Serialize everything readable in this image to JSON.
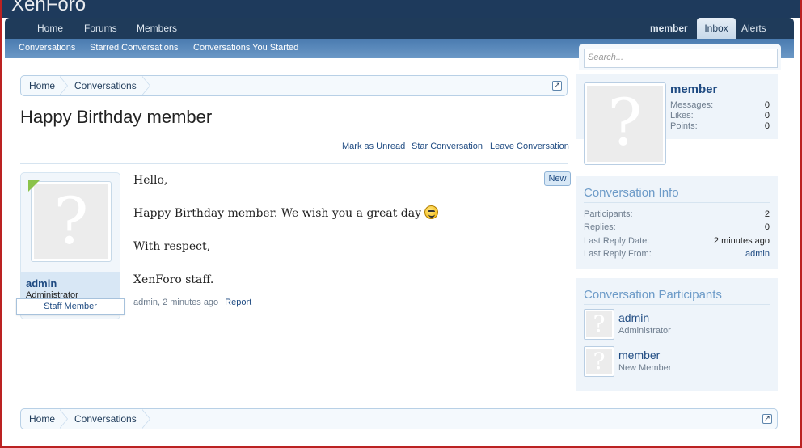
{
  "header": {
    "logo": "XenForo"
  },
  "nav": {
    "tabs": [
      "Home",
      "Forums",
      "Members"
    ],
    "user": "member",
    "inbox": "Inbox",
    "alerts": "Alerts"
  },
  "subnav": [
    "Conversations",
    "Starred Conversations",
    "Conversations You Started"
  ],
  "search": {
    "placeholder": "Search..."
  },
  "breadcrumb": [
    "Home",
    "Conversations"
  ],
  "page": {
    "title": "Happy Birthday member",
    "actions": [
      "Mark as Unread",
      "Star Conversation",
      "Leave Conversation"
    ]
  },
  "message": {
    "author": "admin",
    "author_title": "Administrator",
    "badge": "Staff Member",
    "new_label": "New",
    "lines": [
      "Hello,",
      "Happy Birthday member. We wish you a great day",
      "With respect,",
      "XenForo staff."
    ],
    "meta": "admin, 2 minutes ago",
    "report": "Report"
  },
  "sidebar": {
    "visitor": {
      "name": "member",
      "stats": [
        {
          "label": "Messages:",
          "value": "0"
        },
        {
          "label": "Likes:",
          "value": "0"
        },
        {
          "label": "Points:",
          "value": "0"
        }
      ]
    },
    "info": {
      "heading": "Conversation Info",
      "rows": [
        {
          "label": "Participants:",
          "value": "2"
        },
        {
          "label": "Replies:",
          "value": "0"
        },
        {
          "label": "Last Reply Date:",
          "value": "2 minutes ago"
        },
        {
          "label": "Last Reply From:",
          "value": "admin"
        }
      ]
    },
    "participants": {
      "heading": "Conversation Participants",
      "list": [
        {
          "name": "admin",
          "title": "Administrator"
        },
        {
          "name": "member",
          "title": "New Member"
        }
      ]
    }
  }
}
